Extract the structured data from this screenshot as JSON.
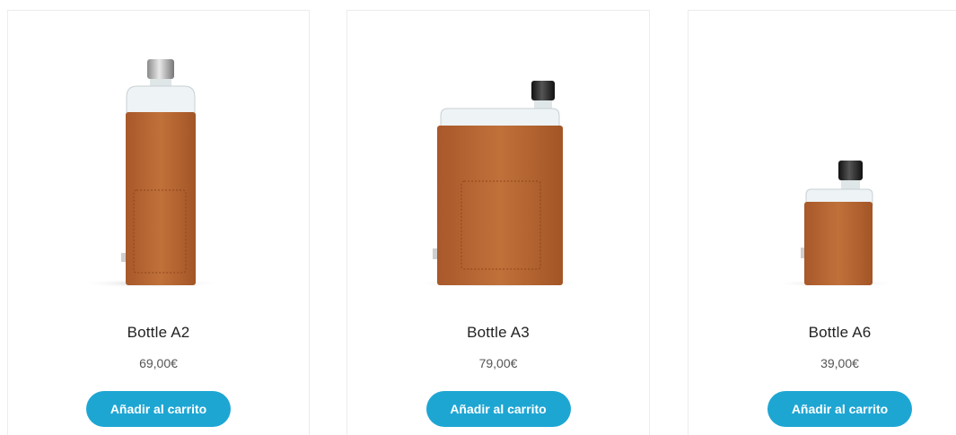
{
  "products": [
    {
      "name": "Bottle A2",
      "price": "69,00€",
      "cta": "Añadir al carrito"
    },
    {
      "name": "Bottle A3",
      "price": "79,00€",
      "cta": "Añadir al carrito"
    },
    {
      "name": "Bottle A6",
      "price": "39,00€",
      "cta": "Añadir al carrito"
    }
  ],
  "colors": {
    "button": "#1ea6d3",
    "leather": "#b7672f",
    "title": "#222222",
    "price": "#555555"
  }
}
